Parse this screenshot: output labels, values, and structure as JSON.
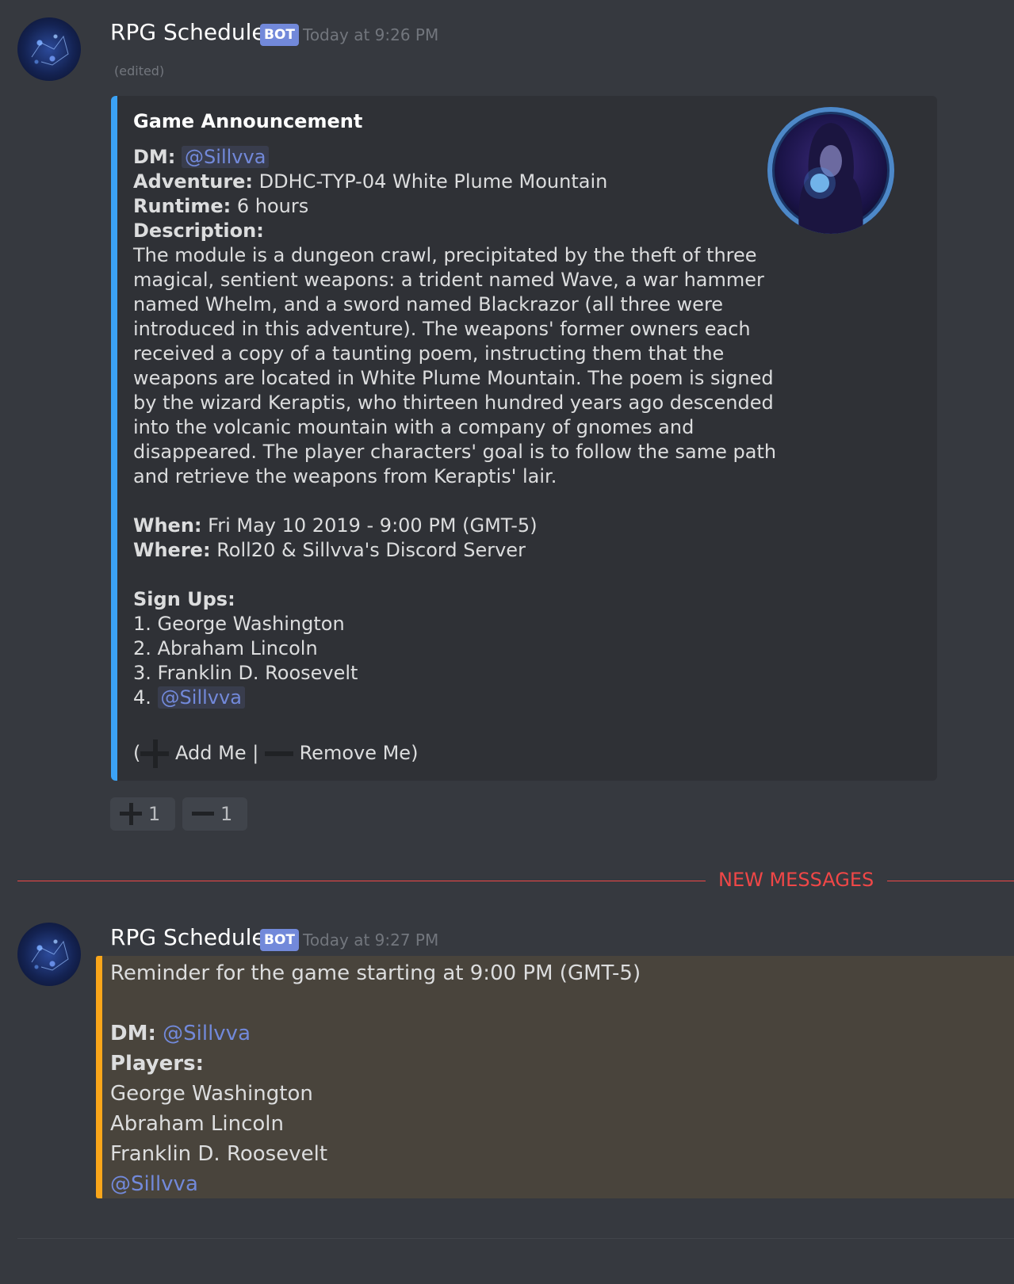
{
  "message1": {
    "author": "RPG Schedule",
    "bot_tag": "BOT",
    "timestamp": "Today at 9:26 PM",
    "edited": "(edited)",
    "embed": {
      "title": "Game Announcement",
      "dm_label": "DM:",
      "dm_value": "@Sillvva",
      "adventure_label": "Adventure:",
      "adventure_value": "DDHC-TYP-04 White Plume Mountain",
      "runtime_label": "Runtime:",
      "runtime_value": "6 hours",
      "description_label": "Description:",
      "description_lines": [
        "The module is a dungeon crawl, precipitated by the theft of three",
        "magical, sentient weapons: a trident named Wave, a war hammer",
        "named Whelm, and a sword named Blackrazor (all three were",
        "introduced in this adventure). The weapons' former owners each",
        "received a copy of a taunting poem, instructing them that the",
        "weapons are located in White Plume Mountain. The poem is signed",
        "by the wizard Keraptis, who thirteen hundred years ago descended",
        "into the volcanic mountain with a company of gnomes and",
        "disappeared. The player characters' goal is to follow the same path",
        "and retrieve the weapons from Keraptis' lair."
      ],
      "when_label": "When:",
      "when_value": "Fri May 10 2019 - 9:00 PM (GMT-5)",
      "where_label": "Where:",
      "where_value": "Roll20 & Sillvva's Discord Server",
      "signups_label": "Sign Ups:",
      "signups": [
        "1. George Washington",
        "2. Abraham Lincoln",
        "3. Franklin D. Roosevelt"
      ],
      "signup_4_prefix": "4.",
      "signup_4_mention": "@Sillvva",
      "open_paren": "(",
      "add_me": "Add Me |",
      "remove_me": "Remove Me)"
    },
    "reactions": [
      {
        "icon": "plus-icon",
        "count": "1"
      },
      {
        "icon": "minus-icon",
        "count": "1"
      }
    ]
  },
  "divider": {
    "label": "NEW MESSAGES",
    "color": "#f04747"
  },
  "message2": {
    "author": "RPG Schedule",
    "bot_tag": "BOT",
    "timestamp": "Today at 9:27 PM",
    "reminder": "Reminder for the game starting at 9:00 PM (GMT-5)",
    "dm_label": "DM:",
    "dm_value": "@Sillvva",
    "players_label": "Players:",
    "players": [
      "George Washington",
      "Abraham Lincoln",
      "Franklin D. Roosevelt"
    ],
    "player_mention": "@Sillvva",
    "highlight_color": "#faa61a"
  },
  "colors": {
    "background": "#36393f",
    "embed_background": "#2f3136",
    "embed_accent": "#3ba2f5",
    "mention": "#7289da",
    "bot_tag": "#7289da"
  }
}
